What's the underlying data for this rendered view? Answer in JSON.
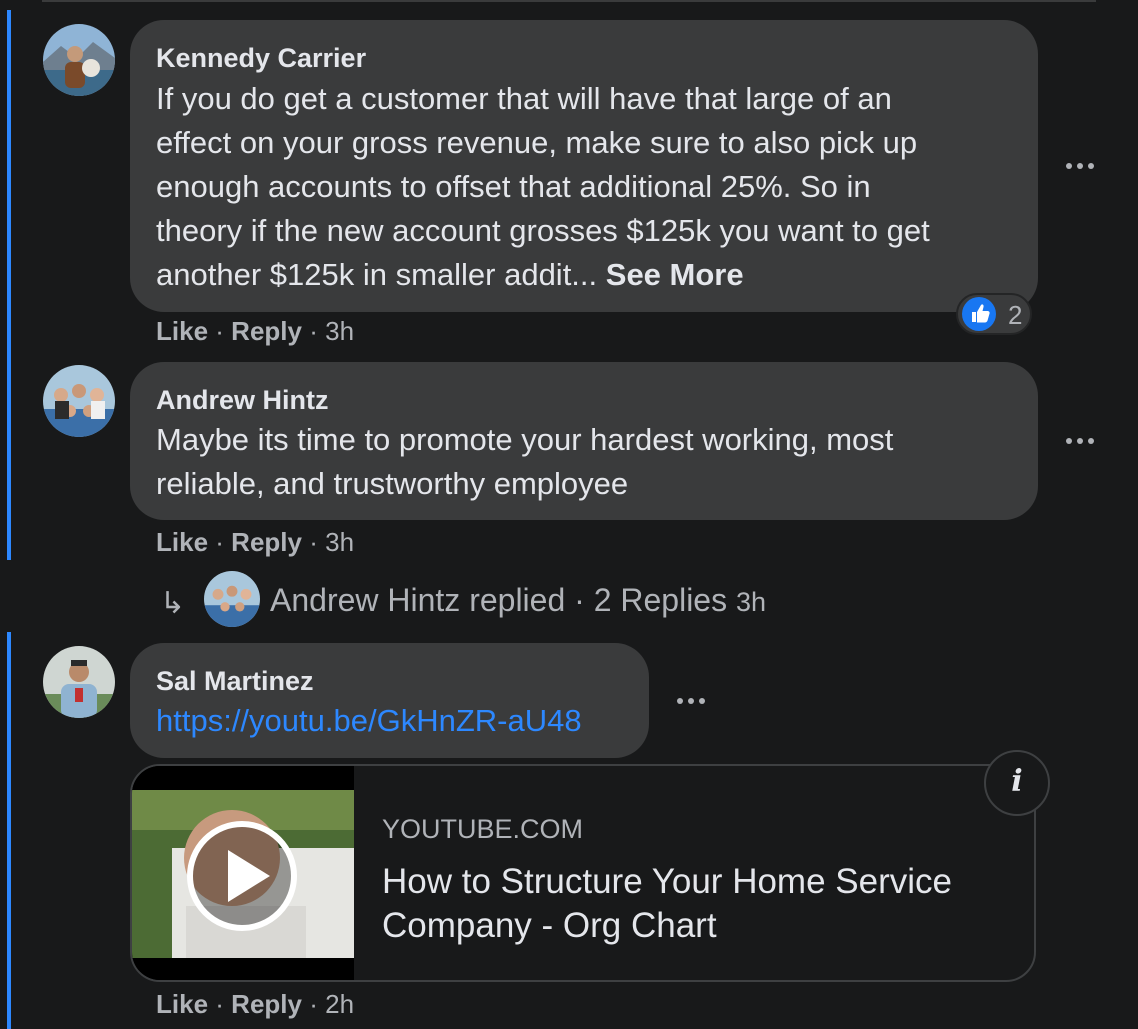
{
  "comments": [
    {
      "author": "Kennedy Carrier",
      "lines": [
        "If you do get a customer that will have that large of an",
        "effect on your gross revenue, make sure to also pick up",
        "enough accounts to offset that additional 25%. So in",
        "theory if the new account grosses $125k you want to get",
        "another $125k in smaller addit... "
      ],
      "see_more": "See More",
      "like": "Like",
      "reply": "Reply",
      "time": "3h",
      "reaction_count": "2",
      "reaction_icon": "thumbs-up-icon"
    },
    {
      "author": "Andrew Hintz",
      "lines": [
        "Maybe its time to promote your hardest working, most",
        "reliable, and trustworthy employee"
      ],
      "like": "Like",
      "reply": "Reply",
      "time": "3h",
      "replies_summary": {
        "text": "Andrew Hintz replied · 2 Replies",
        "time": "3h"
      }
    },
    {
      "author": "Sal Martinez",
      "link_text": "https://youtu.be/GkHnZR-aU48",
      "like": "Like",
      "reply": "Reply",
      "time": "2h",
      "preview": {
        "domain": "YOUTUBE.COM",
        "title": "How to Structure Your Home Service Company - Org Chart"
      }
    }
  ],
  "separator": "·",
  "colors": {
    "background": "#18191a",
    "bubble": "#3a3b3c",
    "accent": "#2d88ff",
    "primary_text": "#e4e6eb",
    "secondary_text": "#b0b3b8"
  }
}
